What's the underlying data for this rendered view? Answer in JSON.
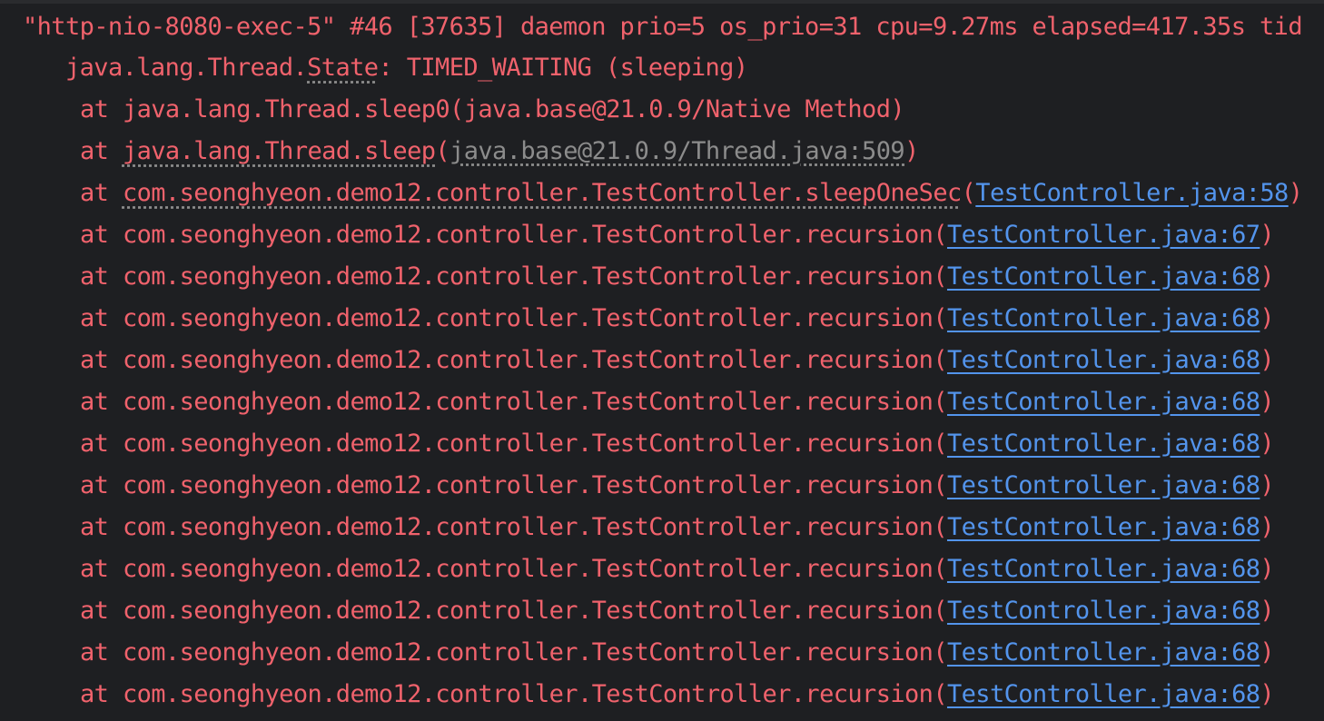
{
  "thread_header": "\"http-nio-8080-exec-5\" #46 [37635] daemon prio=5 os_prio=31 cpu=9.27ms elapsed=417.35s tid",
  "state": {
    "prefix": "java.lang.Thread.",
    "keyword": "State",
    "suffix": ": TIMED_WAITING (sleeping)"
  },
  "frames": [
    {
      "prefix": "at java.lang.Thread.sleep0(java.base@21.0.9/Native Method)"
    },
    {
      "prefix": "at ",
      "method": "java.lang.Thread.sleep",
      "open": "(",
      "location": "java.base@21.0.9/Thread.java:509",
      "close": ")"
    },
    {
      "prefix": "at ",
      "method": "com.seonghyeon.demo12.controller.TestController.sleepOneSec",
      "open": "(",
      "link": "TestController.java:58",
      "close": ")"
    },
    {
      "prefix": "at com.seonghyeon.demo12.controller.TestController.recursion(",
      "link": "TestController.java:67",
      "close": ")"
    },
    {
      "prefix": "at com.seonghyeon.demo12.controller.TestController.recursion(",
      "link": "TestController.java:68",
      "close": ")"
    },
    {
      "prefix": "at com.seonghyeon.demo12.controller.TestController.recursion(",
      "link": "TestController.java:68",
      "close": ")"
    },
    {
      "prefix": "at com.seonghyeon.demo12.controller.TestController.recursion(",
      "link": "TestController.java:68",
      "close": ")"
    },
    {
      "prefix": "at com.seonghyeon.demo12.controller.TestController.recursion(",
      "link": "TestController.java:68",
      "close": ")"
    },
    {
      "prefix": "at com.seonghyeon.demo12.controller.TestController.recursion(",
      "link": "TestController.java:68",
      "close": ")"
    },
    {
      "prefix": "at com.seonghyeon.demo12.controller.TestController.recursion(",
      "link": "TestController.java:68",
      "close": ")"
    },
    {
      "prefix": "at com.seonghyeon.demo12.controller.TestController.recursion(",
      "link": "TestController.java:68",
      "close": ")"
    },
    {
      "prefix": "at com.seonghyeon.demo12.controller.TestController.recursion(",
      "link": "TestController.java:68",
      "close": ")"
    },
    {
      "prefix": "at com.seonghyeon.demo12.controller.TestController.recursion(",
      "link": "TestController.java:68",
      "close": ")"
    },
    {
      "prefix": "at com.seonghyeon.demo12.controller.TestController.recursion(",
      "link": "TestController.java:68",
      "close": ")"
    },
    {
      "prefix": "at com.seonghyeon.demo12.controller.TestController.recursion(",
      "link": "TestController.java:68",
      "close": ")"
    }
  ],
  "colors": {
    "background": "#1e1f22",
    "error_text": "#f0626c",
    "link": "#5394ec",
    "muted": "#8c8c8c"
  }
}
